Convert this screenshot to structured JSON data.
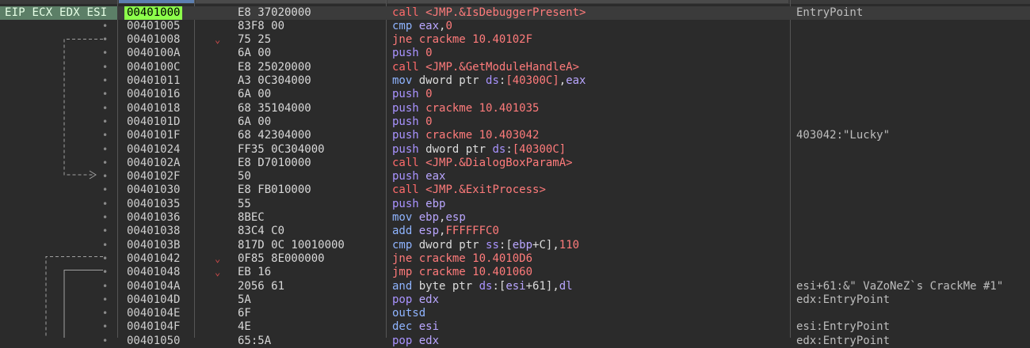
{
  "registers_label": "EIP ECX EDX ESI",
  "colors": {
    "eip_bg": "#8cff4b",
    "reg_bg": "#5c7f67",
    "call": "#ff6b6b",
    "jump": "#ff7a7a",
    "mnemonic": "#8fb4ff",
    "push": "#a993ff"
  },
  "rows": [
    {
      "addr": "00401000",
      "bytes": "E8 37020000",
      "mnem": "call",
      "ops": "<JMP.&IsDebuggerPresent>",
      "comment": "EntryPoint",
      "eip": true
    },
    {
      "addr": "00401005",
      "bytes": "83F8 00",
      "mnem": "cmp",
      "ops": "eax,0",
      "comment": ""
    },
    {
      "addr": "00401008",
      "bytes": "75 25",
      "mnem": "jne",
      "ops": "crackme 10.40102F",
      "comment": "",
      "jump": true
    },
    {
      "addr": "0040100A",
      "bytes": "6A 00",
      "mnem": "push",
      "ops": "0",
      "comment": ""
    },
    {
      "addr": "0040100C",
      "bytes": "E8 25020000",
      "mnem": "call",
      "ops": "<JMP.&GetModuleHandleA>",
      "comment": ""
    },
    {
      "addr": "00401011",
      "bytes": "A3 0C304000",
      "mnem": "mov",
      "ops": "dword ptr ds:[40300C],eax",
      "comment": ""
    },
    {
      "addr": "00401016",
      "bytes": "6A 00",
      "mnem": "push",
      "ops": "0",
      "comment": ""
    },
    {
      "addr": "00401018",
      "bytes": "68 35104000",
      "mnem": "push",
      "ops": "crackme 10.401035",
      "comment": ""
    },
    {
      "addr": "0040101D",
      "bytes": "6A 00",
      "mnem": "push",
      "ops": "0",
      "comment": ""
    },
    {
      "addr": "0040101F",
      "bytes": "68 42304000",
      "mnem": "push",
      "ops": "crackme 10.403042",
      "comment": "403042:\"Lucky\""
    },
    {
      "addr": "00401024",
      "bytes": "FF35 0C304000",
      "mnem": "push",
      "ops": "dword ptr ds:[40300C]",
      "comment": ""
    },
    {
      "addr": "0040102A",
      "bytes": "E8 D7010000",
      "mnem": "call",
      "ops": "<JMP.&DialogBoxParamA>",
      "comment": ""
    },
    {
      "addr": "0040102F",
      "bytes": "50",
      "mnem": "push",
      "ops": "eax",
      "comment": ""
    },
    {
      "addr": "00401030",
      "bytes": "E8 FB010000",
      "mnem": "call",
      "ops": "<JMP.&ExitProcess>",
      "comment": ""
    },
    {
      "addr": "00401035",
      "bytes": "55",
      "mnem": "push",
      "ops": "ebp",
      "comment": ""
    },
    {
      "addr": "00401036",
      "bytes": "8BEC",
      "mnem": "mov",
      "ops": "ebp,esp",
      "comment": ""
    },
    {
      "addr": "00401038",
      "bytes": "83C4 C0",
      "mnem": "add",
      "ops": "esp,FFFFFFC0",
      "comment": ""
    },
    {
      "addr": "0040103B",
      "bytes": "817D 0C 10010000",
      "mnem": "cmp",
      "ops": "dword ptr ss:[ebp+C],110",
      "comment": ""
    },
    {
      "addr": "00401042",
      "bytes": "0F85 8E000000",
      "mnem": "jne",
      "ops": "crackme 10.4010D6",
      "comment": "",
      "jump": true
    },
    {
      "addr": "00401048",
      "bytes": "EB 16",
      "mnem": "jmp",
      "ops": "crackme 10.401060",
      "comment": "",
      "jump": true
    },
    {
      "addr": "0040104A",
      "bytes": "2056 61",
      "mnem": "and",
      "ops": "byte ptr ds:[esi+61],dl",
      "comment": "esi+61:&\" VaZoNeZ`s CrackMe #1\""
    },
    {
      "addr": "0040104D",
      "bytes": "5A",
      "mnem": "pop",
      "ops": "edx",
      "comment": "edx:EntryPoint"
    },
    {
      "addr": "0040104E",
      "bytes": "6F",
      "mnem": "outsd",
      "ops": "",
      "comment": ""
    },
    {
      "addr": "0040104F",
      "bytes": "4E",
      "mnem": "dec",
      "ops": "esi",
      "comment": "esi:EntryPoint"
    },
    {
      "addr": "00401050",
      "bytes": "65:5A",
      "mnem": "pop",
      "ops": "edx",
      "comment": "edx:EntryPoint"
    }
  ]
}
